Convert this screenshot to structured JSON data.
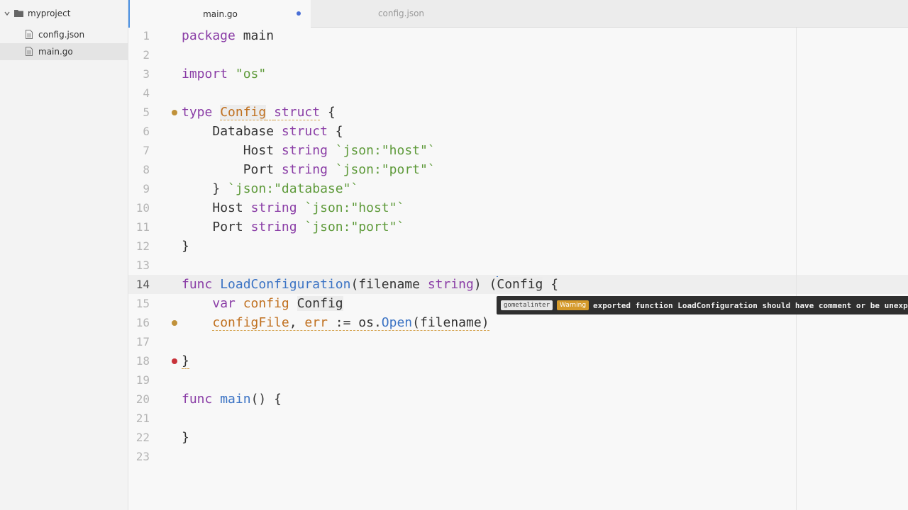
{
  "sidebar": {
    "project": "myproject",
    "files": [
      "config.json",
      "main.go"
    ],
    "selected": "main.go"
  },
  "tabs": [
    {
      "label": "main.go",
      "active": true,
      "modified": true
    },
    {
      "label": "config.json",
      "active": false,
      "modified": false
    }
  ],
  "editor": {
    "current_line": 14,
    "line_numbers": [
      "1",
      "2",
      "3",
      "4",
      "5",
      "6",
      "7",
      "8",
      "9",
      "10",
      "11",
      "12",
      "13",
      "14",
      "15",
      "16",
      "17",
      "18",
      "19",
      "20",
      "21",
      "22",
      "23"
    ]
  },
  "code": {
    "l1": {
      "kw": "package",
      "rest": " main"
    },
    "l3": {
      "kw": "import",
      "str": "\"os\""
    },
    "l5": {
      "kw": "type",
      "type": "Config",
      "kw2": "struct",
      "brace": " {"
    },
    "l6": {
      "name": "Database",
      "kw": "struct",
      "brace": " {"
    },
    "l7": {
      "name": "Host",
      "kw": "string",
      "tag": "`json:\"host\"`"
    },
    "l8": {
      "name": "Port",
      "kw": "string",
      "tag": "`json:\"port\"`"
    },
    "l9": {
      "brace": "}",
      "tag": "`json:\"database\"`"
    },
    "l10": {
      "name": "Host",
      "kw": "string",
      "tag": "`json:\"host\"`"
    },
    "l11": {
      "name": "Port",
      "kw": "string",
      "tag": "`json:\"port\"`"
    },
    "l12": {
      "brace": "}"
    },
    "l14": {
      "kw": "func",
      "fn": "LoadConfiguration",
      "open": "(",
      "param": "filename",
      "kw2": "string",
      "close": ") (",
      "ret": "Config",
      "brace": " {"
    },
    "l15": {
      "kw": "var",
      "var": "config",
      "type": "Config"
    },
    "l16": {
      "v1": "configFile",
      "comma": ", ",
      "v2": "err",
      "op": " := os.",
      "fn": "Open",
      "args": "(filename)"
    },
    "l18": {
      "brace": "}"
    },
    "l20": {
      "kw": "func",
      "fn": "main",
      "rest": "() {"
    },
    "l22": {
      "brace": "}"
    }
  },
  "tooltip": {
    "linter": "gometalinter",
    "level": "Warning",
    "message": "exported function LoadConfiguration should have comment or be unexported"
  },
  "colors": {
    "keyword": "#8a3da6",
    "type": "#c0701f",
    "function": "#3b73c4",
    "string": "#5e9a3a",
    "warning_marker": "#c0913a",
    "error_marker": "#c8323a",
    "active_tab_accent": "#4a90e2"
  },
  "icons": [
    "chevron-down-icon",
    "folder-icon",
    "file-icon"
  ]
}
